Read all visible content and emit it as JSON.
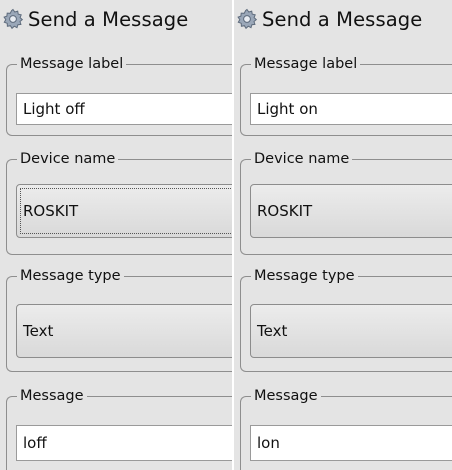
{
  "panels": [
    {
      "title": "Send a Message",
      "groups": {
        "message_label": {
          "legend": "Message label",
          "value": "Light off"
        },
        "device_name": {
          "legend": "Device name",
          "value": "ROSKIT"
        },
        "message_type": {
          "legend": "Message type",
          "value": "Text"
        },
        "message": {
          "legend": "Message",
          "value": "loff"
        }
      }
    },
    {
      "title": "Send a Message",
      "groups": {
        "message_label": {
          "legend": "Message label",
          "value": "Light on"
        },
        "device_name": {
          "legend": "Device name",
          "value": "ROSKIT"
        },
        "message_type": {
          "legend": "Message type",
          "value": "Text"
        },
        "message": {
          "legend": "Message",
          "value": "lon"
        }
      }
    }
  ],
  "icons": {
    "title_icon": "gear-icon"
  }
}
